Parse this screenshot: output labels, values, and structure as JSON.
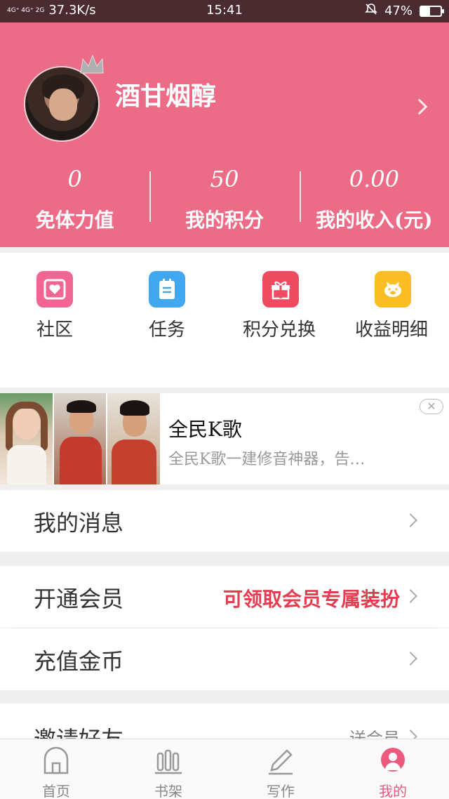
{
  "status_bar": {
    "network": "4G⁺ 4G⁺ 2G",
    "speed": "37.3K/s",
    "time": "15:41",
    "battery_text": "47%",
    "battery_level": 0.47
  },
  "profile": {
    "username": "酒甘烟醇",
    "stats": [
      {
        "value": "0",
        "label": "免体力值"
      },
      {
        "value": "50",
        "label": "我的积分"
      },
      {
        "value": "0.00",
        "label": "我的收入(元)"
      }
    ]
  },
  "grid": [
    {
      "label": "社区",
      "icon": "community-icon",
      "color": "#f06592"
    },
    {
      "label": "任务",
      "icon": "task-icon",
      "color": "#41a7ef"
    },
    {
      "label": "积分兑换",
      "icon": "gift-icon",
      "color": "#ee4a60"
    },
    {
      "label": "收益明细",
      "icon": "piggy-icon",
      "color": "#fbbd24"
    }
  ],
  "ad": {
    "title": "全民K歌",
    "desc": "全民K歌一建修音神器，告…",
    "close": "✕"
  },
  "rows": {
    "messages": "我的消息",
    "vip": "开通会员",
    "vip_extra": "可领取会员专属装扮",
    "recharge": "充值金币",
    "invite": "邀请好友",
    "invite_extra": "送会员"
  },
  "nav": [
    {
      "label": "首页",
      "icon": "home-icon"
    },
    {
      "label": "书架",
      "icon": "bookshelf-icon"
    },
    {
      "label": "写作",
      "icon": "pen-icon"
    },
    {
      "label": "我的",
      "icon": "profile-icon"
    }
  ],
  "colors": {
    "brand": "#ec6b86",
    "accent_red": "#e43d50"
  }
}
